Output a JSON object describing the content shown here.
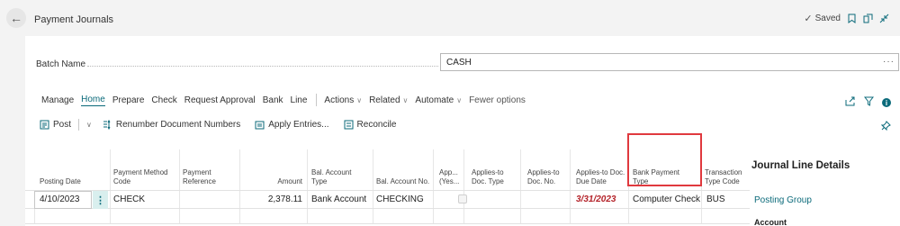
{
  "header": {
    "page_title": "Payment Journals",
    "saved_label": "Saved"
  },
  "batch": {
    "label": "Batch Name",
    "value": "CASH",
    "more": "···"
  },
  "actions": {
    "tabs": [
      "Manage",
      "Home",
      "Prepare",
      "Check",
      "Request Approval",
      "Bank",
      "Line"
    ],
    "active_tab": "Home",
    "menus": [
      "Actions",
      "Related",
      "Automate"
    ],
    "fewer": "Fewer options"
  },
  "commands": {
    "post": "Post",
    "renumber": "Renumber Document Numbers",
    "apply": "Apply Entries...",
    "reconcile": "Reconcile"
  },
  "table": {
    "headers": {
      "posting_date": "Posting Date",
      "payment_method": "Payment Method Code",
      "payment_ref": "Payment Reference",
      "amount": "Amount",
      "bal_account_type": "Bal. Account Type",
      "bal_account_no": "Bal. Account No.",
      "applies_yes": "App... (Yes...",
      "applies_doc_type": "Applies-to Doc. Type",
      "applies_doc_no": "Applies-to Doc. No.",
      "applies_due": "Applies-to Doc. Due Date",
      "bank_payment_type": "Bank Payment Type",
      "transaction_type": "Transaction Type Code"
    },
    "row": {
      "posting_date": "4/10/2023",
      "payment_method": "CHECK",
      "amount": "2,378.11",
      "bal_account_type": "Bank Account",
      "bal_account_no": "CHECKING",
      "applies_due": "3/31/2023",
      "bank_payment_type": "Computer Check",
      "transaction_type": "BUS"
    }
  },
  "details": {
    "title": "Journal Line Details",
    "posting_group": "Posting Group",
    "account": "Account"
  },
  "colors": {
    "accent": "#0b6a7a",
    "highlight": "#e0393e",
    "due_date": "#b4232a"
  }
}
